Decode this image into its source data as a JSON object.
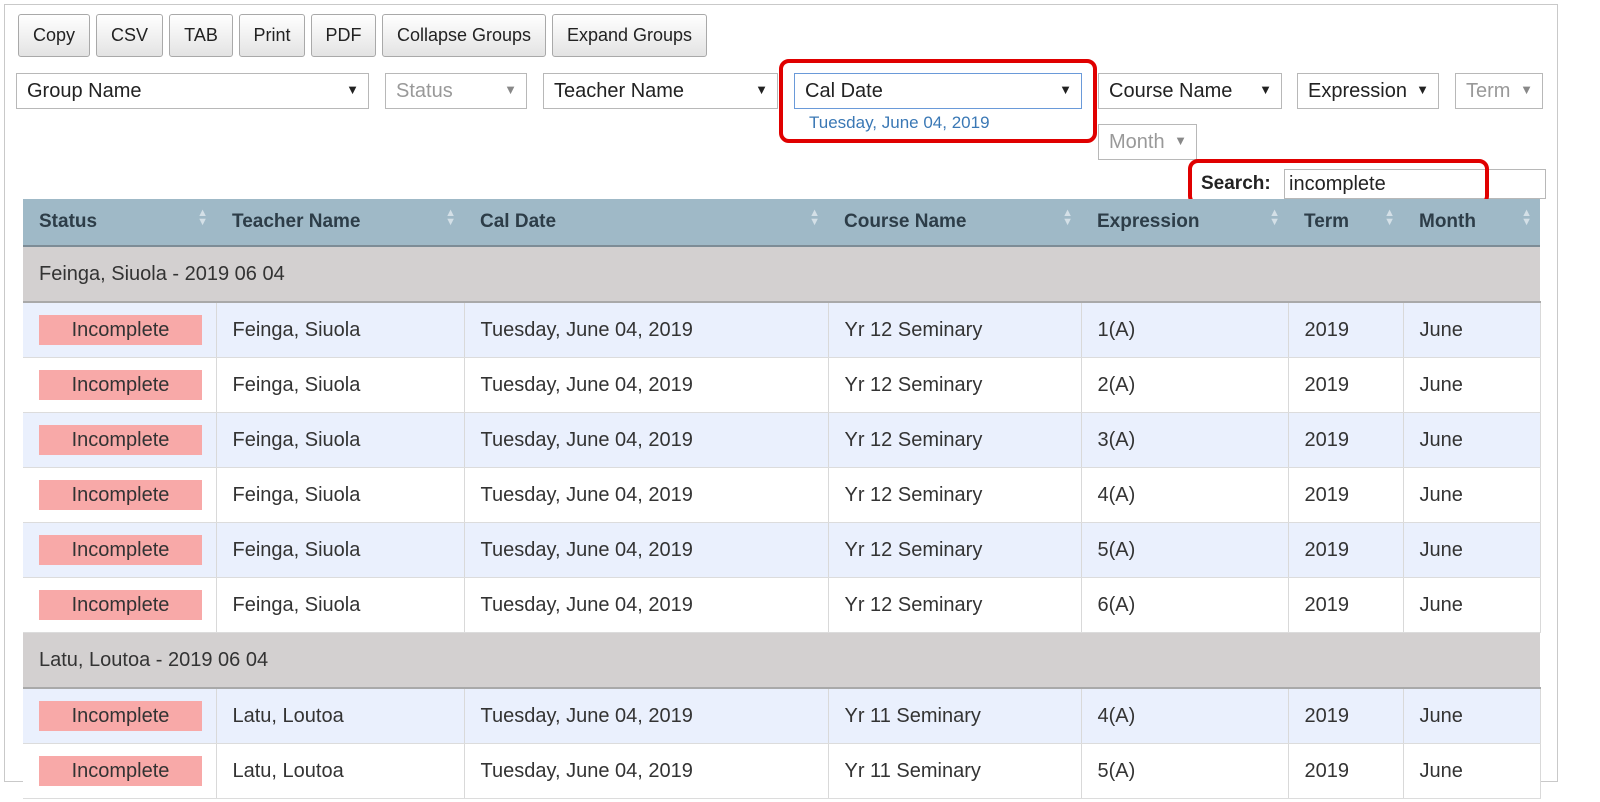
{
  "toolbar": {
    "buttons": [
      "Copy",
      "CSV",
      "TAB",
      "Print",
      "PDF",
      "Collapse Groups",
      "Expand Groups"
    ]
  },
  "filters": {
    "group_name": "Group Name",
    "status": "Status",
    "teacher_name": "Teacher Name",
    "cal_date": "Cal Date",
    "cal_date_selected": "Tuesday, June 04, 2019",
    "course_name": "Course Name",
    "expression": "Expression",
    "term": "Term",
    "month": "Month"
  },
  "search": {
    "label": "Search:",
    "value": "incomplete"
  },
  "table": {
    "columns": [
      "Status",
      "Teacher Name",
      "Cal Date",
      "Course Name",
      "Expression",
      "Term",
      "Month"
    ],
    "groups": [
      {
        "title": "Feinga, Siuola - 2019 06 04",
        "rows": [
          [
            "Incomplete",
            "Feinga, Siuola",
            "Tuesday, June 04, 2019",
            "Yr 12 Seminary",
            "1(A)",
            "2019",
            "June"
          ],
          [
            "Incomplete",
            "Feinga, Siuola",
            "Tuesday, June 04, 2019",
            "Yr 12 Seminary",
            "2(A)",
            "2019",
            "June"
          ],
          [
            "Incomplete",
            "Feinga, Siuola",
            "Tuesday, June 04, 2019",
            "Yr 12 Seminary",
            "3(A)",
            "2019",
            "June"
          ],
          [
            "Incomplete",
            "Feinga, Siuola",
            "Tuesday, June 04, 2019",
            "Yr 12 Seminary",
            "4(A)",
            "2019",
            "June"
          ],
          [
            "Incomplete",
            "Feinga, Siuola",
            "Tuesday, June 04, 2019",
            "Yr 12 Seminary",
            "5(A)",
            "2019",
            "June"
          ],
          [
            "Incomplete",
            "Feinga, Siuola",
            "Tuesday, June 04, 2019",
            "Yr 12 Seminary",
            "6(A)",
            "2019",
            "June"
          ]
        ]
      },
      {
        "title": "Latu, Loutoa - 2019 06 04",
        "rows": [
          [
            "Incomplete",
            "Latu, Loutoa",
            "Tuesday, June 04, 2019",
            "Yr 11 Seminary",
            "4(A)",
            "2019",
            "June"
          ],
          [
            "Incomplete",
            "Latu, Loutoa",
            "Tuesday, June 04, 2019",
            "Yr 11 Seminary",
            "5(A)",
            "2019",
            "June"
          ]
        ]
      }
    ]
  },
  "colors": {
    "header_bg": "#9fb9c7",
    "group_bg": "#d3d0d0",
    "row_alt_bg": "#eaf0fd",
    "badge_bg": "#f8a9a8",
    "highlight_box": "#e00000",
    "selected_date_text": "#3a78b5"
  }
}
